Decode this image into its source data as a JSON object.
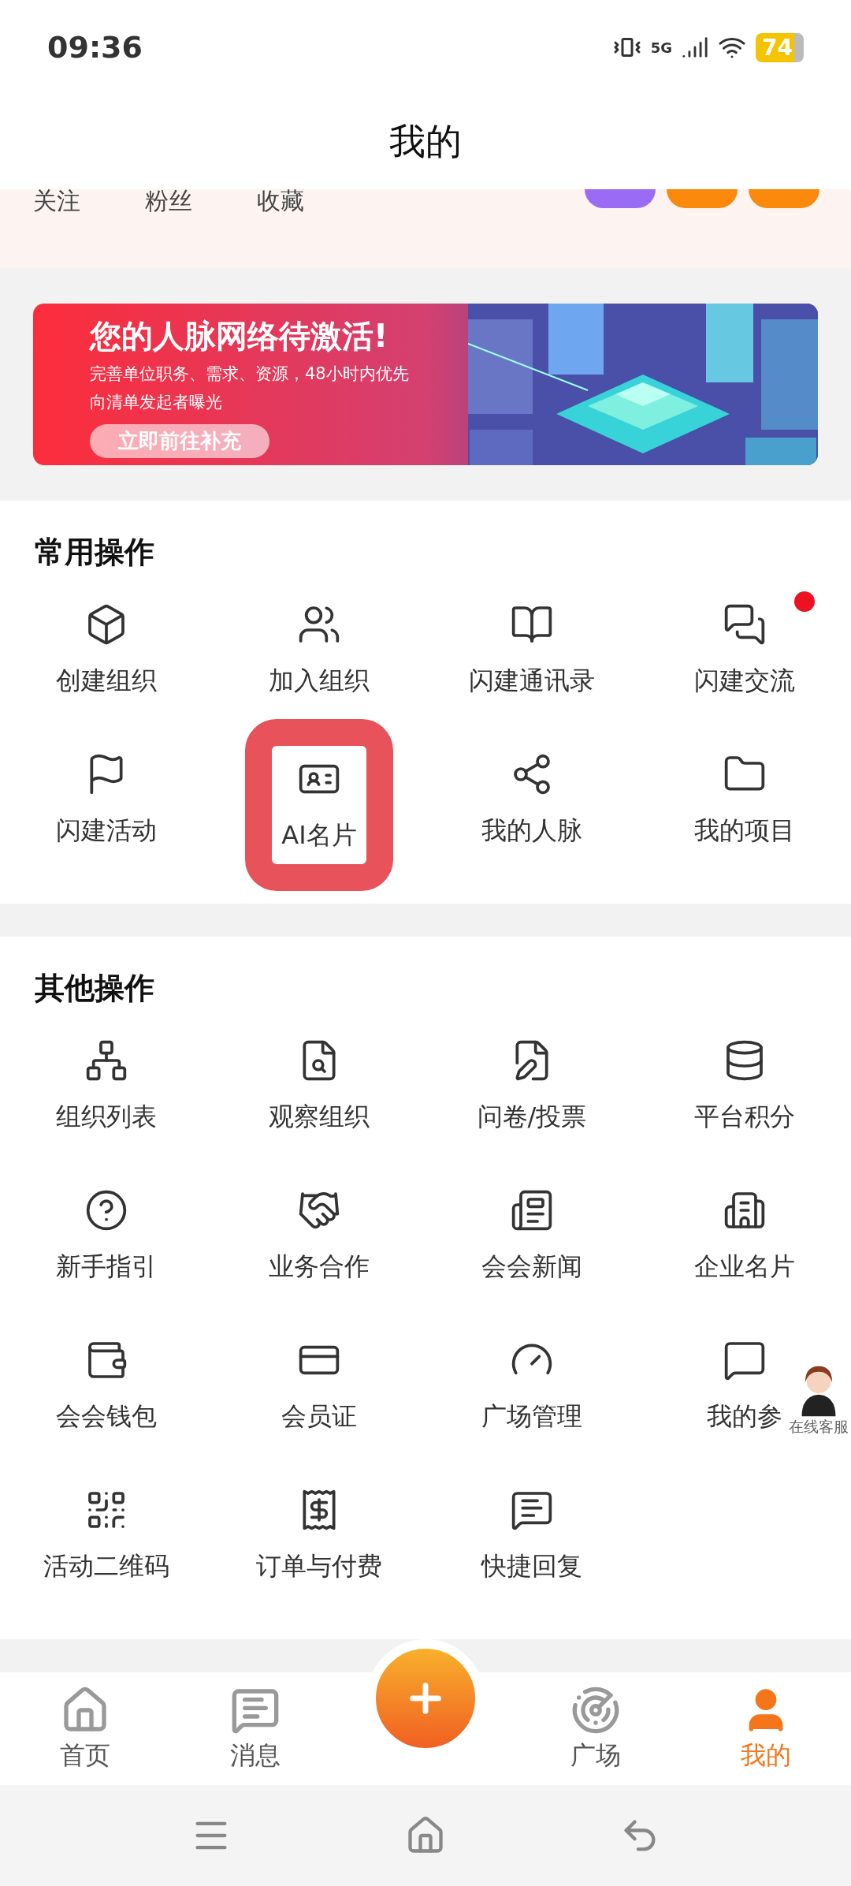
{
  "status_bar": {
    "time": "09:36",
    "network": "5G",
    "battery": "74"
  },
  "header": {
    "title": "我的"
  },
  "profile_stats": [
    {
      "label": "关注"
    },
    {
      "label": "粉丝"
    },
    {
      "label": "收藏"
    }
  ],
  "banner": {
    "title": "您的人脉网络待激活!",
    "subtitle_lines": [
      "完善单位职务、需求、资源，48小时内优先",
      "向清单发起者曝光"
    ],
    "button": "立即前往补充",
    "kind": "picture"
  },
  "sections": [
    {
      "title": "常用操作",
      "items": [
        {
          "label": "创建组织",
          "highlighted": false,
          "badge_dot": false
        },
        {
          "label": "加入组织",
          "highlighted": false,
          "badge_dot": false
        },
        {
          "label": "闪建通讯录",
          "highlighted": false,
          "badge_dot": false
        },
        {
          "label": "闪建交流",
          "highlighted": false,
          "badge_dot": true
        },
        {
          "label": "闪建活动",
          "highlighted": false,
          "badge_dot": false
        },
        {
          "label": "AI名片",
          "highlighted": true,
          "badge_dot": false
        },
        {
          "label": "我的人脉",
          "highlighted": false,
          "badge_dot": false
        },
        {
          "label": "我的项目",
          "highlighted": false,
          "badge_dot": false
        }
      ]
    },
    {
      "title": "其他操作",
      "items": [
        {
          "label": "组织列表",
          "highlighted": false,
          "badge_dot": false
        },
        {
          "label": "观察组织",
          "highlighted": false,
          "badge_dot": false
        },
        {
          "label": "问卷/投票",
          "highlighted": false,
          "badge_dot": false
        },
        {
          "label": "平台积分",
          "highlighted": false,
          "badge_dot": false
        },
        {
          "label": "新手指引",
          "highlighted": false,
          "badge_dot": false
        },
        {
          "label": "业务合作",
          "highlighted": false,
          "badge_dot": false
        },
        {
          "label": "会会新闻",
          "highlighted": false,
          "badge_dot": false
        },
        {
          "label": "企业名片",
          "highlighted": false,
          "badge_dot": false
        },
        {
          "label": "会会钱包",
          "highlighted": false,
          "badge_dot": false
        },
        {
          "label": "会员证",
          "highlighted": false,
          "badge_dot": false
        },
        {
          "label": "广场管理",
          "highlighted": false,
          "badge_dot": false
        },
        {
          "label": "我的参",
          "highlighted": false,
          "badge_dot": false
        },
        {
          "label": "活动二维码",
          "highlighted": false,
          "badge_dot": false
        },
        {
          "label": "订单与付费",
          "highlighted": false,
          "badge_dot": false
        },
        {
          "label": "快捷回复",
          "highlighted": false,
          "badge_dot": false
        }
      ]
    }
  ],
  "floating_service": {
    "label": "在线客服"
  },
  "bottom_nav": [
    {
      "kind": "tab",
      "label": "首页",
      "selected": false
    },
    {
      "kind": "tab",
      "label": "消息",
      "selected": false
    },
    {
      "kind": "create"
    },
    {
      "kind": "tab",
      "label": "广场",
      "selected": false
    },
    {
      "kind": "tab",
      "label": "我的",
      "selected": true
    }
  ]
}
